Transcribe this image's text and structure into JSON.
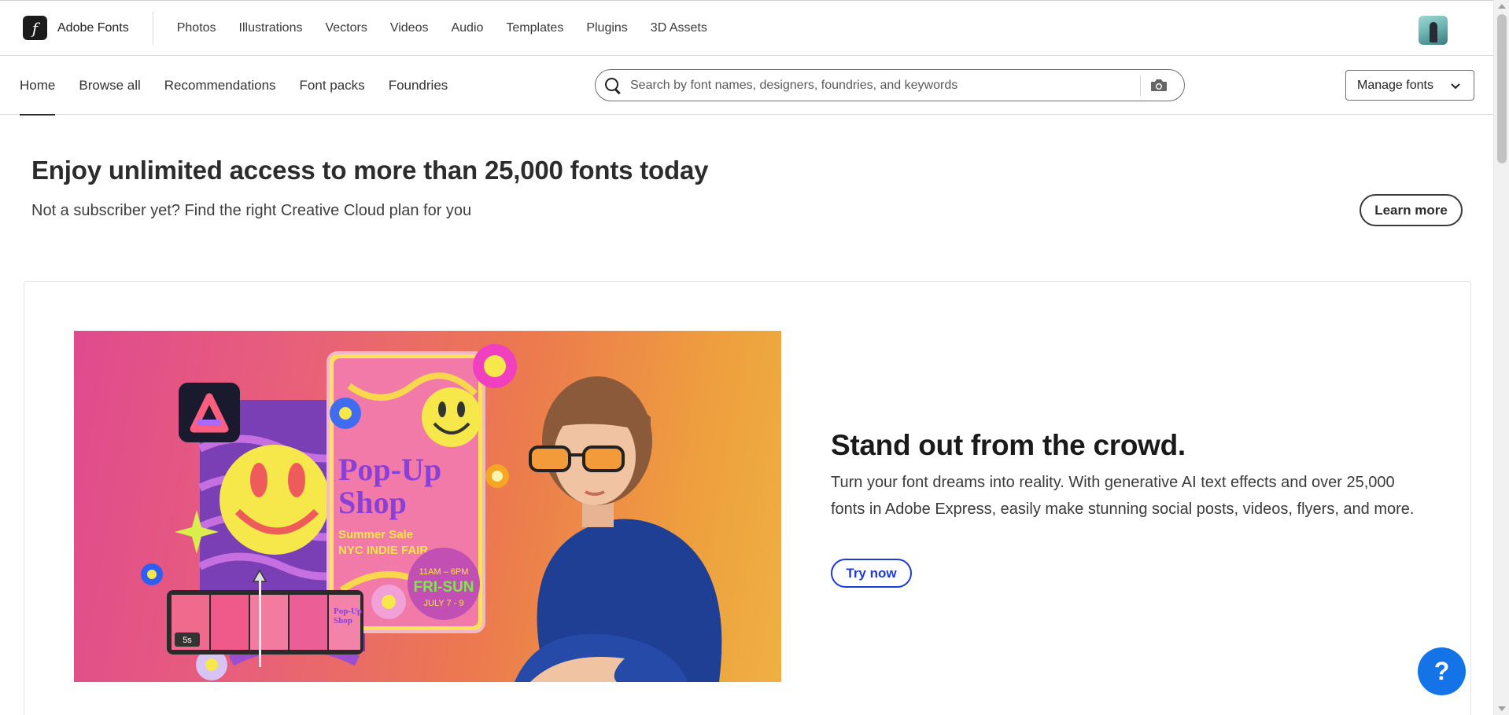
{
  "brand": {
    "name": "Adobe Fonts",
    "logo_glyph": "f"
  },
  "topnav": [
    {
      "label": "Photos"
    },
    {
      "label": "Illustrations"
    },
    {
      "label": "Vectors"
    },
    {
      "label": "Videos"
    },
    {
      "label": "Audio"
    },
    {
      "label": "Templates"
    },
    {
      "label": "Plugins"
    },
    {
      "label": "3D Assets"
    }
  ],
  "subnav": [
    {
      "label": "Home",
      "active": true
    },
    {
      "label": "Browse all"
    },
    {
      "label": "Recommendations"
    },
    {
      "label": "Font packs"
    },
    {
      "label": "Foundries"
    }
  ],
  "search": {
    "placeholder": "Search by font names, designers, foundries, and keywords",
    "value": ""
  },
  "manage_fonts": {
    "label": "Manage fonts"
  },
  "promo": {
    "title": "Enjoy unlimited access to more than 25,000 fonts today",
    "subtitle": "Not a subscriber yet? Find the right Creative Cloud plan for you",
    "button": "Learn more"
  },
  "card": {
    "title": "Stand out from the crowd.",
    "body": "Turn your font dreams into reality. With generative AI text effects and over 25,000 fonts in Adobe Express, easily make stunning social posts, videos, flyers, and more.",
    "button": "Try now",
    "hero": {
      "poster_title_1": "Pop-Up",
      "poster_title_2": "Shop",
      "poster_line_1": "Summer Sale",
      "poster_line_2": "NYC INDIE FAIR",
      "badge_time": "11AM – 6PM",
      "badge_days": "FRI-SUN",
      "badge_dates": "JULY 7 - 9",
      "clip_duration": "5s",
      "mini_title_1": "Pop-Up",
      "mini_title_2": "Shop"
    }
  },
  "help": {
    "label": "?"
  },
  "colors": {
    "accent_blue": "#1e3bd7",
    "help_blue": "#1473e6"
  }
}
